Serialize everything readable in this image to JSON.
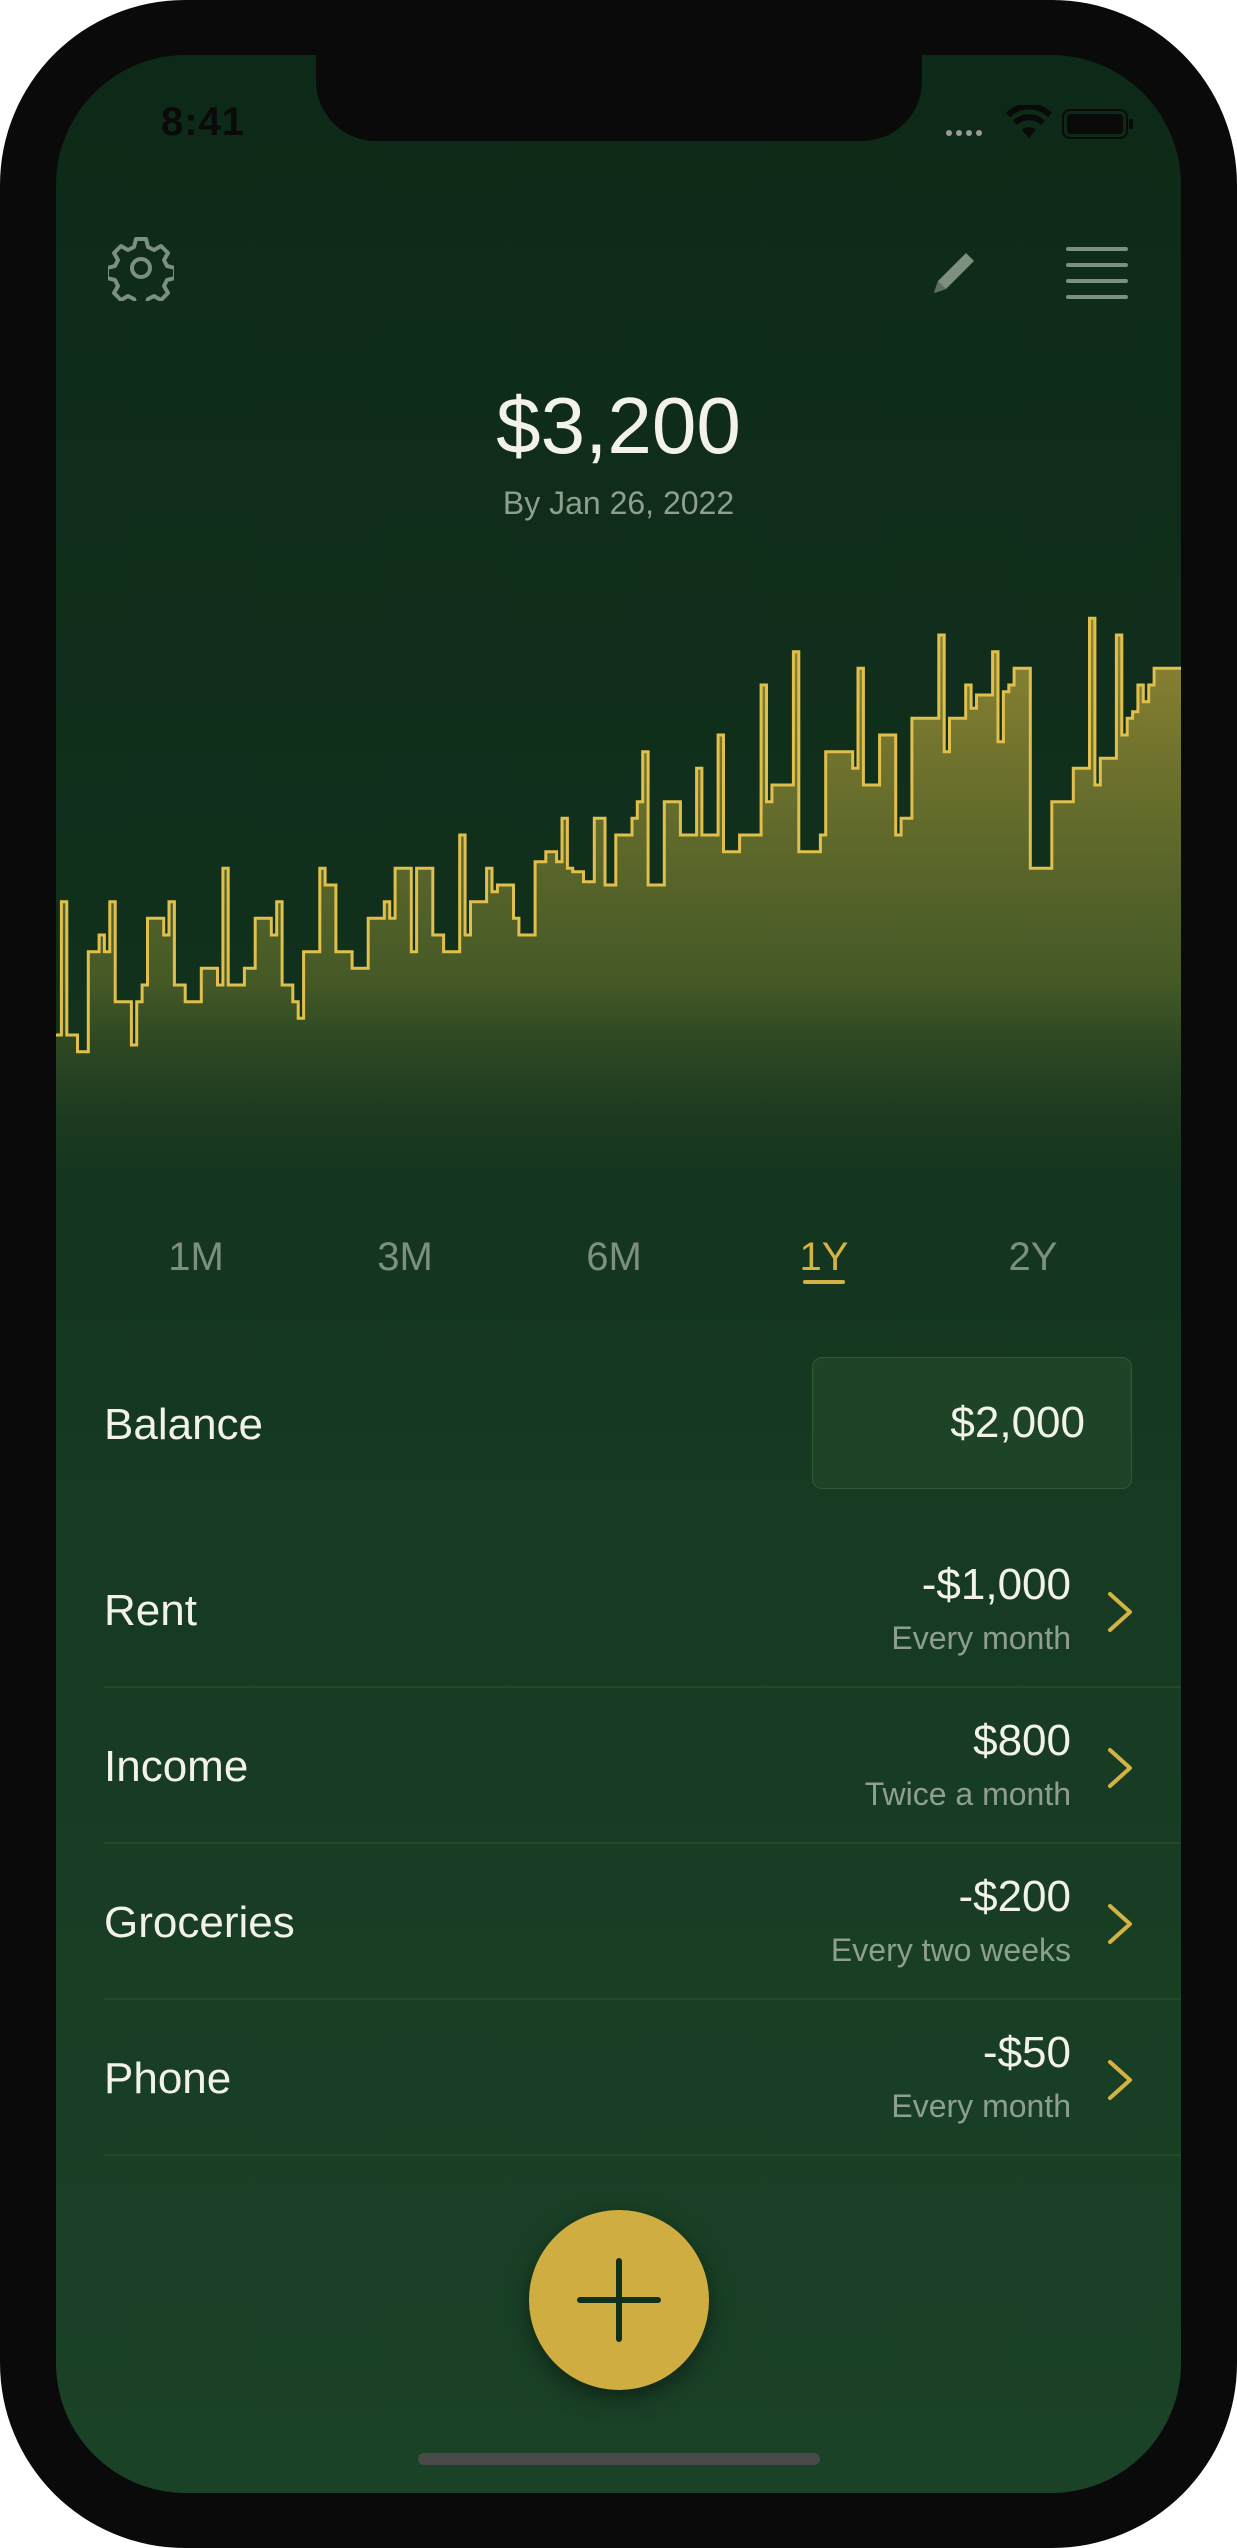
{
  "status_bar": {
    "time": "8:41"
  },
  "header": {
    "settings_icon": "gear-icon",
    "edit_icon": "pencil-icon",
    "menu_icon": "hamburger-menu-icon"
  },
  "summary": {
    "amount": "$3,200",
    "date": "By Jan 26, 2022"
  },
  "colors": {
    "background": "#11301c",
    "accent": "#d4b344",
    "line": "#e0bf4d",
    "text": "#f2f2ea",
    "muted": "#8f9f8d"
  },
  "chart_data": {
    "type": "area",
    "title": "",
    "xlabel": "",
    "ylabel": "",
    "step": true,
    "grid": false,
    "values": [
      1950,
      2350,
      1950,
      1950,
      1900,
      1900,
      2200,
      2200,
      2250,
      2200,
      2350,
      2050,
      2050,
      2050,
      1920,
      2050,
      2100,
      2300,
      2300,
      2300,
      2250,
      2350,
      2100,
      2100,
      2050,
      2050,
      2050,
      2150,
      2150,
      2150,
      2100,
      2450,
      2100,
      2100,
      2100,
      2150,
      2150,
      2300,
      2300,
      2300,
      2250,
      2350,
      2100,
      2100,
      2050,
      2000,
      2200,
      2200,
      2200,
      2450,
      2400,
      2400,
      2200,
      2200,
      2200,
      2150,
      2150,
      2150,
      2300,
      2300,
      2300,
      2350,
      2300,
      2450,
      2450,
      2450,
      2200,
      2450,
      2450,
      2450,
      2250,
      2250,
      2200,
      2200,
      2200,
      2550,
      2250,
      2350,
      2350,
      2350,
      2450,
      2380,
      2400,
      2400,
      2400,
      2300,
      2250,
      2250,
      2250,
      2470,
      2470,
      2500,
      2500,
      2470,
      2600,
      2450,
      2440,
      2440,
      2410,
      2410,
      2600,
      2600,
      2400,
      2400,
      2550,
      2550,
      2550,
      2600,
      2650,
      2800,
      2400,
      2400,
      2400,
      2650,
      2650,
      2650,
      2550,
      2550,
      2550,
      2750,
      2550,
      2550,
      2550,
      2850,
      2500,
      2500,
      2500,
      2550,
      2550,
      2550,
      2550,
      3000,
      2650,
      2700,
      2700,
      2700,
      2700,
      3100,
      2500,
      2500,
      2500,
      2500,
      2550,
      2800,
      2800,
      2800,
      2800,
      2800,
      2750,
      3050,
      2700,
      2700,
      2700,
      2850,
      2850,
      2850,
      2550,
      2600,
      2600,
      2900,
      2900,
      2900,
      2900,
      2900,
      3150,
      2800,
      2900,
      2900,
      2900,
      3000,
      2930,
      2970,
      2970,
      2970,
      3100,
      2830,
      2980,
      3000,
      3050,
      3050,
      3050,
      2450,
      2450,
      2450,
      2450,
      2650,
      2650,
      2650,
      2650,
      2750,
      2750,
      2750,
      3200,
      2700,
      2780,
      2780,
      2780,
      3150,
      2850,
      2900,
      2920,
      3000,
      2950,
      3000,
      3050,
      3050,
      3050,
      3050,
      3050
    ],
    "ylim": [
      1500,
      3300
    ],
    "range_selected": "1Y"
  },
  "range_tabs": [
    {
      "label": "1M",
      "active": false
    },
    {
      "label": "3M",
      "active": false
    },
    {
      "label": "6M",
      "active": false
    },
    {
      "label": "1Y",
      "active": true
    },
    {
      "label": "2Y",
      "active": false
    }
  ],
  "balance": {
    "label": "Balance",
    "value": "$2,000"
  },
  "entries": [
    {
      "label": "Rent",
      "amount": "-$1,000",
      "frequency": "Every month"
    },
    {
      "label": "Income",
      "amount": "$800",
      "frequency": "Twice a month"
    },
    {
      "label": "Groceries",
      "amount": "-$200",
      "frequency": "Every two weeks"
    },
    {
      "label": "Phone",
      "amount": "-$50",
      "frequency": "Every month"
    }
  ],
  "add_button": {
    "icon": "plus-icon"
  }
}
